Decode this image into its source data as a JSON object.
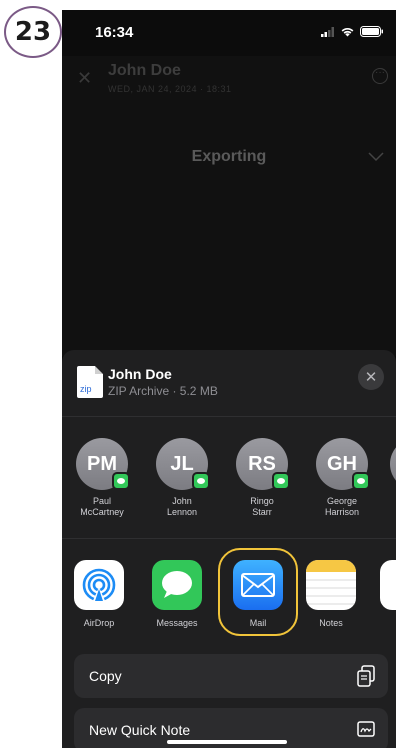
{
  "step_badge": "23",
  "status_bar": {
    "time": "16:34"
  },
  "background_app": {
    "title": "John Doe",
    "subtitle": "WED, JAN 24, 2024 · 18:31",
    "exporting_label": "Exporting"
  },
  "share_sheet": {
    "file": {
      "name": "John Doe",
      "meta": "ZIP Archive · 5.2 MB",
      "icon_label": "zip"
    },
    "close_glyph": "✕",
    "contacts": [
      {
        "initials": "PM",
        "name_line1": "Paul",
        "name_line2": "McCartney"
      },
      {
        "initials": "JL",
        "name_line1": "John",
        "name_line2": "Lennon"
      },
      {
        "initials": "RS",
        "name_line1": "Ringo",
        "name_line2": "Starr"
      },
      {
        "initials": "GH",
        "name_line1": "George",
        "name_line2": "Harrison"
      }
    ],
    "apps": [
      {
        "label": "AirDrop",
        "icon": "airdrop-icon"
      },
      {
        "label": "Messages",
        "icon": "messages-icon"
      },
      {
        "label": "Mail",
        "icon": "mail-icon",
        "highlighted": true
      },
      {
        "label": "Notes",
        "icon": "notes-icon"
      }
    ],
    "actions": [
      {
        "label": "Copy",
        "icon": "copy-icon"
      },
      {
        "label": "New Quick Note",
        "icon": "quick-note-icon"
      }
    ]
  },
  "colors": {
    "highlight": "#f1c43a",
    "messages_green": "#32c759",
    "mail_blue": "#1e8cf5",
    "sheet_bg": "#1f1f20"
  }
}
